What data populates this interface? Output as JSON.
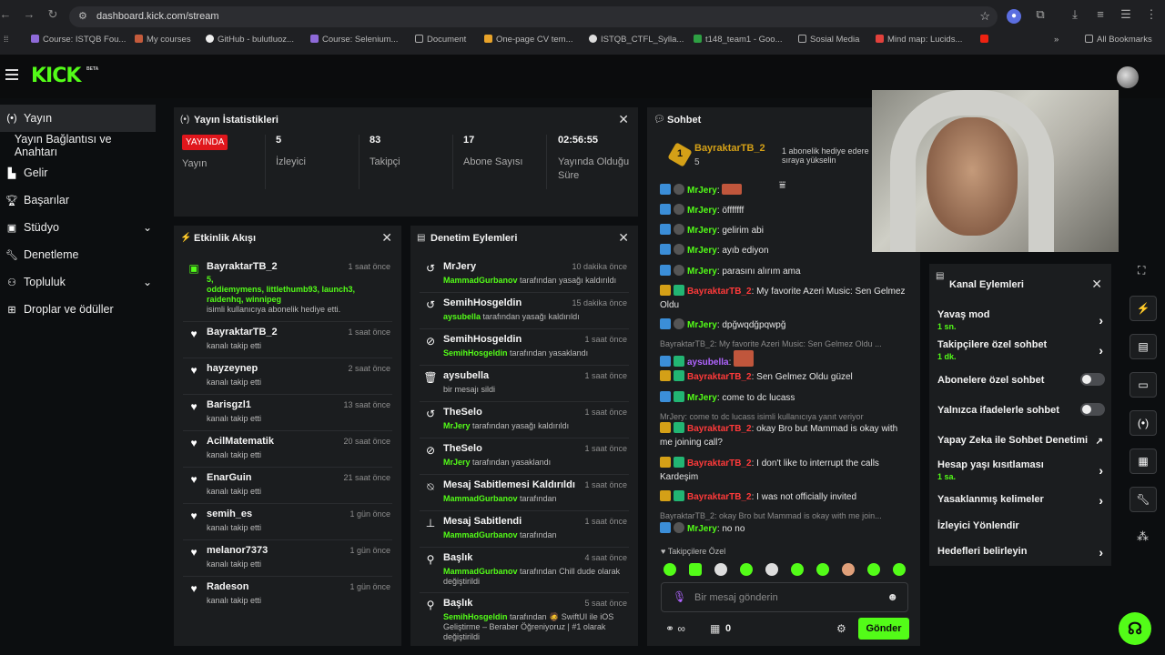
{
  "browser": {
    "url": "dashboard.kick.com/stream",
    "bookmarks": [
      "Course: ISTQB Fou...",
      "My courses",
      "GitHub - bulutluoz...",
      "Course: Selenium...",
      "Document",
      "One-page CV tem...",
      "ISTQB_CTFL_Sylla...",
      "t148_team1 - Goo...",
      "Sosial Media",
      "Mind map: Lucids...",
      "All Bookmarks"
    ]
  },
  "brand": {
    "logo": "KICK",
    "beta": "BETA",
    "accent": "#53fc18"
  },
  "nav": [
    "Yayın",
    "Yayın Bağlantısı ve Anahtarı",
    "Gelir",
    "Başarılar",
    "Stüdyo",
    "Denetleme",
    "Topluluk",
    "Droplar ve ödüller"
  ],
  "stats": {
    "title": "Yayın İstatistikleri",
    "live": "YAYINDA",
    "live_label": "Yayın",
    "viewers": "5",
    "viewers_label": "İzleyici",
    "followers": "83",
    "followers_label": "Takipçi",
    "subs": "17",
    "subs_label": "Abone Sayısı",
    "duration": "02:56:55",
    "duration_label": "Yayında Olduğu Süre"
  },
  "activity": {
    "title": "Etkinlik Akışı",
    "items": [
      {
        "name": "BayraktarTB_2",
        "time": "1 saat önce",
        "gift": "5,",
        "users": "oddiemymens, littlethumb93, launch3, raidenhq, winnipeg",
        "sub": "isimli kullanıcıya abonelik hediye etti."
      },
      {
        "name": "BayraktarTB_2",
        "time": "1 saat önce",
        "sub": "kanalı takip etti"
      },
      {
        "name": "hayzeynep",
        "time": "2 saat önce",
        "sub": "kanalı takip etti"
      },
      {
        "name": "Barisgzl1",
        "time": "13 saat önce",
        "sub": "kanalı takip etti"
      },
      {
        "name": "AcilMatematik",
        "time": "20 saat önce",
        "sub": "kanalı takip etti"
      },
      {
        "name": "EnarGuin",
        "time": "21 saat önce",
        "sub": "kanalı takip etti"
      },
      {
        "name": "semih_es",
        "time": "1 gün önce",
        "sub": "kanalı takip etti"
      },
      {
        "name": "melanor7373",
        "time": "1 gün önce",
        "sub": "kanalı takip etti"
      },
      {
        "name": "Radeson",
        "time": "1 gün önce",
        "sub": "kanalı takip etti"
      }
    ]
  },
  "moderation": {
    "title": "Denetim Eylemleri",
    "items": [
      {
        "name": "MrJery",
        "time": "10 dakika önce",
        "mod": "MammadGurbanov",
        "sub": "tarafından yasağı kaldırıldı"
      },
      {
        "name": "SemihHosgeldin",
        "time": "15 dakika önce",
        "mod": "aysubella",
        "sub": "tarafından yasağı kaldırıldı"
      },
      {
        "name": "SemihHosgeldin",
        "time": "1 saat önce",
        "mod": "SemihHosgeldin",
        "sub": "tarafından yasaklandı"
      },
      {
        "name": "aysubella",
        "time": "1 saat önce",
        "mod": "",
        "sub": "bir mesajı sildi"
      },
      {
        "name": "TheSelo",
        "time": "1 saat önce",
        "mod": "MrJery",
        "sub": "tarafından yasağı kaldırıldı"
      },
      {
        "name": "TheSelo",
        "time": "1 saat önce",
        "mod": "MrJery",
        "sub": "tarafından yasaklandı"
      },
      {
        "name": "Mesaj Sabitlemesi Kaldırıldı",
        "time": "1 saat önce",
        "mod": "MammadGurbanov",
        "sub": "tarafından"
      },
      {
        "name": "Mesaj Sabitlendi",
        "time": "1 saat önce",
        "mod": "MammadGurbanov",
        "sub": "tarafından"
      },
      {
        "name": "Başlık",
        "time": "4 saat önce",
        "mod": "MammadGurbanov",
        "sub": "tarafından Chill dude olarak değiştirildi"
      },
      {
        "name": "Başlık",
        "time": "5 saat önce",
        "mod": "SemihHosgeldin",
        "sub": "tarafından 🧔 SwiftUI ile iOS Geliştirme – Beraber Öğreniyoruz | #1 olarak değiştirildi"
      }
    ]
  },
  "chat": {
    "title": "Sohbet",
    "pinned_user": "BayraktarTB_2",
    "pinned_count": "5",
    "pinned_rank": "1",
    "pinned_note": "1 abonelik hediye edere sıraya yükselin",
    "messages": [
      {
        "u": "MrJery",
        "t": "",
        "c": "#53fc18"
      },
      {
        "u": "MrJery",
        "t": "öfffffff",
        "c": "#53fc18"
      },
      {
        "u": "MrJery",
        "t": "gelirim abi",
        "c": "#53fc18"
      },
      {
        "u": "MrJery",
        "t": "ayıb ediyon",
        "c": "#53fc18"
      },
      {
        "u": "MrJery",
        "t": "parasını alırım ama",
        "c": "#53fc18"
      },
      {
        "u": "BayraktarTB_2",
        "t": "My favorite Azeri Music: Sen Gelmez Oldu",
        "c": "#ff3a3a"
      },
      {
        "u": "MrJery",
        "t": "dpğwqdğpqwpğ",
        "c": "#53fc18"
      },
      {
        "u": "aysubella",
        "t": "",
        "c": "#b064ff"
      },
      {
        "u": "BayraktarTB_2",
        "t": "Sen Gelmez Oldu güzel",
        "c": "#ff3a3a"
      },
      {
        "u": "MrJery",
        "t": "come to dc lucass",
        "c": "#53fc18"
      },
      {
        "u": "BayraktarTB_2",
        "t": "okay Bro but Mammad is okay with me joining call?",
        "c": "#ff3a3a"
      },
      {
        "u": "BayraktarTB_2",
        "t": "I don't like to interrupt the calls Kardeşim",
        "c": "#ff3a3a"
      },
      {
        "u": "BayraktarTB_2",
        "t": "I was not officially invited",
        "c": "#ff3a3a"
      },
      {
        "u": "MrJery",
        "t": "no no",
        "c": "#53fc18"
      }
    ],
    "replies": [
      "BayraktarTB_2: My favorite Azeri Music: Sen Gelmez Oldu ...",
      "MrJery: come to dc lucass isimli kullanıcıya yanıt veriyor",
      "BayraktarTB_2: okay Bro but Mammad is okay with me join..."
    ],
    "mode": "Takipçilere Özel",
    "placeholder": "Bir mesaj gönderin",
    "points": "0",
    "send": "Gönder"
  },
  "channel_actions": {
    "title": "Kanal Eylemleri",
    "items": [
      {
        "label": "Yavaş mod",
        "sub": "1 sn.",
        "kind": "chev"
      },
      {
        "label": "Takipçilere özel sohbet",
        "sub": "1 dk.",
        "kind": "chev"
      },
      {
        "label": "Abonelere özel sohbet",
        "sub": "",
        "kind": "toggle"
      },
      {
        "label": "Yalnızca ifadelerle sohbet",
        "sub": "",
        "kind": "toggle"
      },
      {
        "label": "Yapay Zeka ile Sohbet Denetimi",
        "sub": "",
        "kind": "ext"
      },
      {
        "label": "Hesap yaşı kısıtlaması",
        "sub": "1 sa.",
        "kind": "chev"
      },
      {
        "label": "Yasaklanmış kelimeler",
        "sub": "",
        "kind": "chev"
      },
      {
        "label": "İzleyici Yönlendir",
        "sub": "",
        "kind": "none"
      },
      {
        "label": "Hedefleri belirleyin",
        "sub": "",
        "kind": "chev"
      }
    ]
  }
}
